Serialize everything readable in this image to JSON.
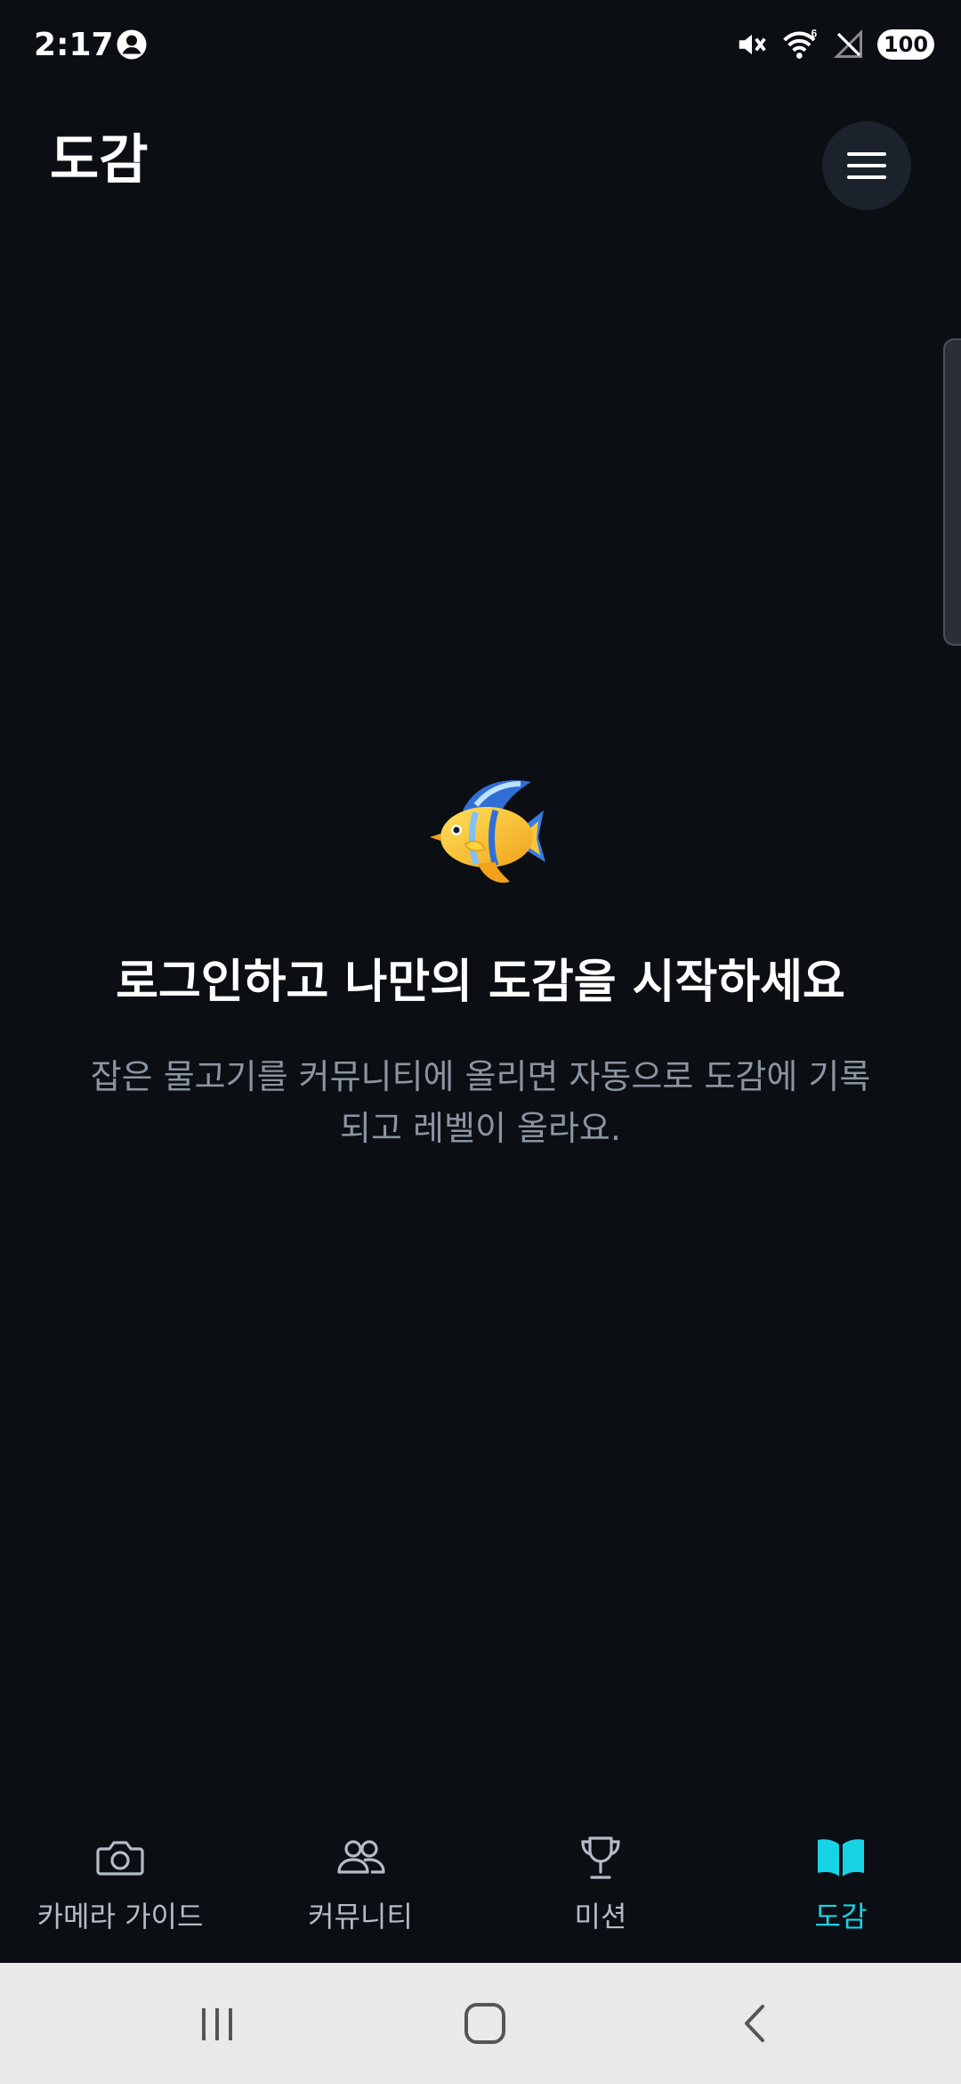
{
  "status_bar": {
    "time": "2:17",
    "battery": "100",
    "icons": [
      "account-icon",
      "mute-icon",
      "wifi-icon",
      "no-signal-icon",
      "battery-icon"
    ]
  },
  "header": {
    "title": "도감",
    "menu_icon": "hamburger-menu-icon"
  },
  "empty_state": {
    "icon": "tropical-fish-emoji",
    "title": "로그인하고 나만의 도감을 시작하세요",
    "description": "잡은 물고기를 커뮤니티에 올리면 자동으로 도감에 기록되고 레벨이 올라요."
  },
  "bottom_nav": {
    "items": [
      {
        "label": "카메라 가이드",
        "icon": "camera-icon",
        "active": false
      },
      {
        "label": "커뮤니티",
        "icon": "people-icon",
        "active": false
      },
      {
        "label": "미션",
        "icon": "trophy-icon",
        "active": false
      },
      {
        "label": "도감",
        "icon": "book-icon",
        "active": true
      }
    ]
  },
  "colors": {
    "background": "#0b0e13",
    "accent": "#18d2e6",
    "muted_text": "#8b95a1",
    "menu_button_bg": "#1b222c"
  }
}
